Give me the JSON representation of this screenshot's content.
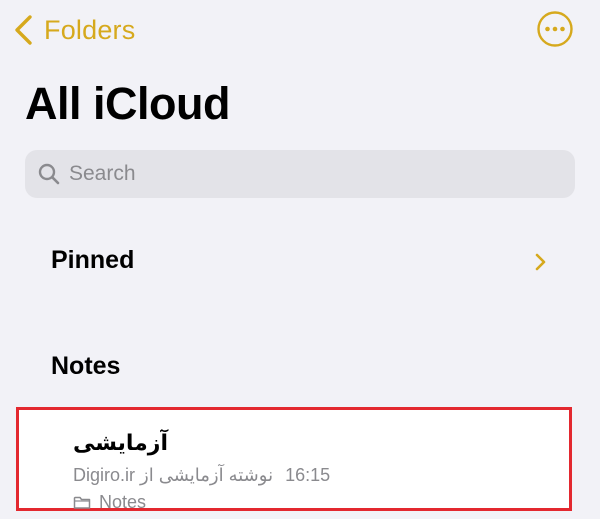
{
  "colors": {
    "accent": "#d6a91d",
    "background": "#f2f2f7",
    "search_fill": "#e3e3e8",
    "secondary_text": "#8a8a8e",
    "highlight_border": "#e3282f"
  },
  "nav": {
    "back_label": "Folders",
    "back_icon": "chevron-left-icon",
    "more_icon": "ellipsis-circle-icon"
  },
  "page": {
    "title": "All iCloud"
  },
  "search": {
    "placeholder": "Search",
    "value": "",
    "icon": "magnifying-glass-icon"
  },
  "pinned": {
    "label": "Pinned",
    "icon": "chevron-right-icon"
  },
  "notes_section": {
    "heading": "Notes",
    "items": [
      {
        "title": "آزمایشی",
        "time": "16:15",
        "preview": "نوشته آزمایشی از Digiro.ir",
        "folder": "Notes",
        "folder_icon": "folder-icon"
      }
    ]
  }
}
